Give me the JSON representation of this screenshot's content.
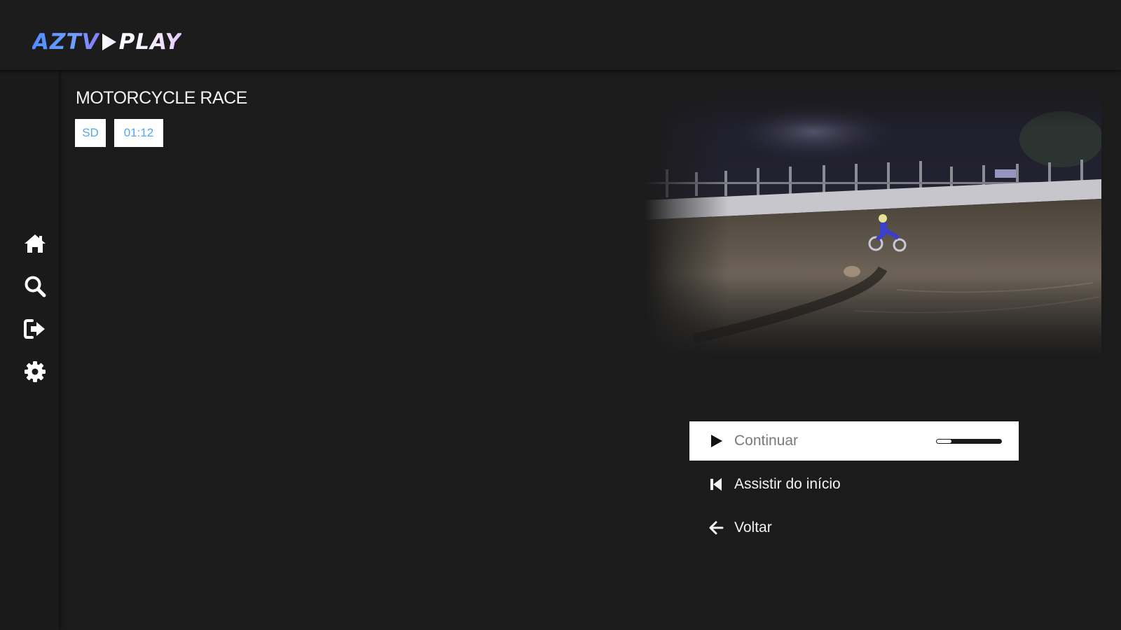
{
  "brand": {
    "name_part_a": "AZTV",
    "name_part_b": "PLAY",
    "colors": {
      "primary": "#4e8cff",
      "secondary": "#ffffff"
    }
  },
  "sidebar": {
    "items": [
      {
        "id": "home",
        "icon": "home-icon"
      },
      {
        "id": "search",
        "icon": "search-icon"
      },
      {
        "id": "logout",
        "icon": "sign-out-icon"
      },
      {
        "id": "settings",
        "icon": "gear-icon"
      }
    ]
  },
  "content": {
    "title": "MOTORCYCLE RACE",
    "quality": "SD",
    "duration": "01:12",
    "thumbnail_icon": "motorcycle-race-thumbnail"
  },
  "actions": [
    {
      "id": "continue",
      "label": "Continuar",
      "icon": "play-icon",
      "focused": true,
      "progress": 0.22
    },
    {
      "id": "restart",
      "label": "Assistir do início",
      "icon": "skip-back-icon",
      "focused": false
    },
    {
      "id": "back",
      "label": "Voltar",
      "icon": "arrow-left-icon",
      "focused": false
    }
  ],
  "colors": {
    "background": "#1b1b1b",
    "badge_text": "#55a6f0",
    "text": "#f2f2f2",
    "focused_label": "#7a7a7a"
  }
}
